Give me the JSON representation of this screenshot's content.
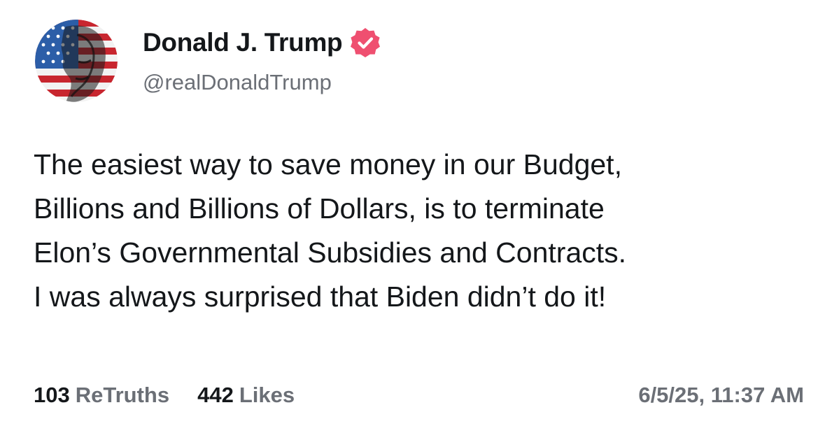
{
  "author": {
    "display_name": "Donald J. Trump",
    "handle": "@realDonaldTrump",
    "verified_icon": "verified-badge-icon",
    "avatar_icon": "profile-avatar"
  },
  "post": {
    "lines": [
      "The easiest way to save money in our Budget,",
      "Billions and Billions of Dollars, is to terminate",
      "Elon’s Governmental Subsidies and Contracts.",
      "I was always surprised that Biden didn’t do it!"
    ]
  },
  "stats": {
    "retruths_count": "103",
    "retruths_label": "ReTruths",
    "likes_count": "442",
    "likes_label": "Likes"
  },
  "timestamp": "6/5/25, 11:37 AM",
  "colors": {
    "text": "#14171a",
    "secondary": "#6b6f76",
    "verified_badge": "#ef4f70"
  }
}
